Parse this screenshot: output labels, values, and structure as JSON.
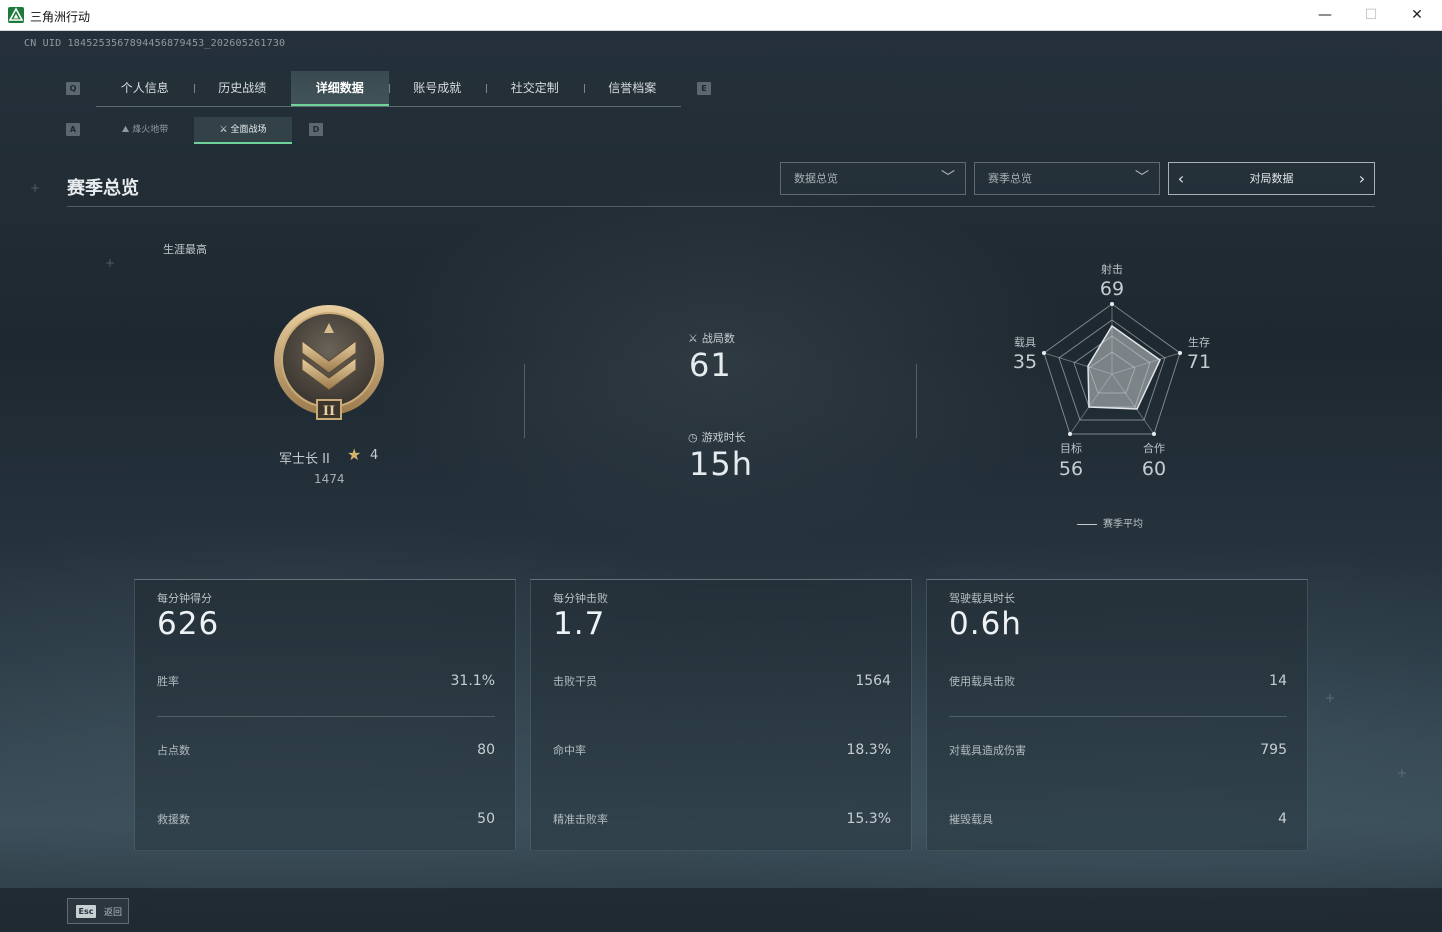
{
  "window": {
    "title": "三角洲行动",
    "controls": {
      "minimize": "—",
      "maximize": "☐",
      "close": "✕"
    }
  },
  "uid": "CN UID 1845253567894456879453_202605261730",
  "tabs": {
    "left_key": "Q",
    "right_key": "E",
    "items": [
      {
        "label": "个人信息"
      },
      {
        "label": "历史战绩"
      },
      {
        "label": "详细数据",
        "active": true
      },
      {
        "label": "账号成就"
      },
      {
        "label": "社交定制"
      },
      {
        "label": "信誉档案"
      }
    ]
  },
  "subtabs": {
    "left_key": "A",
    "right_key": "D",
    "items": [
      {
        "label": "烽火地带",
        "icon": "flame-zone-icon"
      },
      {
        "label": "全面战场",
        "icon": "battlefield-icon",
        "active": true
      }
    ]
  },
  "section": {
    "title": "赛季总览",
    "dropdown1": "数据总览",
    "dropdown2": "赛季总览",
    "pager": "对局数据"
  },
  "career": {
    "label": "生涯最高",
    "rank_name": "军士长 II",
    "stars": "4",
    "score": "1474"
  },
  "middle": {
    "matches_label": "战局数",
    "matches_value": "61",
    "playtime_label": "游戏时长",
    "playtime_value": "15h"
  },
  "radar": {
    "axes": [
      {
        "label": "射击",
        "value": "69"
      },
      {
        "label": "生存",
        "value": "71"
      },
      {
        "label": "合作",
        "value": "60"
      },
      {
        "label": "目标",
        "value": "56"
      },
      {
        "label": "载具",
        "value": "35"
      }
    ],
    "legend": "赛季平均"
  },
  "cards": [
    {
      "title": "每分钟得分",
      "big": "626",
      "rows": [
        {
          "k": "胜率",
          "v": "31.1%"
        },
        {
          "k": "占点数",
          "v": "80"
        },
        {
          "k": "救援数",
          "v": "50"
        }
      ]
    },
    {
      "title": "每分钟击败",
      "big": "1.7",
      "rows": [
        {
          "k": "击败干员",
          "v": "1564"
        },
        {
          "k": "命中率",
          "v": "18.3%"
        },
        {
          "k": "精准击败率",
          "v": "15.3%"
        }
      ]
    },
    {
      "title": "驾驶载具时长",
      "big": "0.6h",
      "rows": [
        {
          "k": "使用载具击败",
          "v": "14"
        },
        {
          "k": "对载具造成伤害",
          "v": "795"
        },
        {
          "k": "摧毁载具",
          "v": "4"
        }
      ]
    }
  ],
  "bottom": {
    "esc_key": "Esc",
    "esc_label": "返回"
  },
  "colors": {
    "accent": "#6ed39a",
    "star": "#d4b36b",
    "bg": "#1e2830"
  }
}
